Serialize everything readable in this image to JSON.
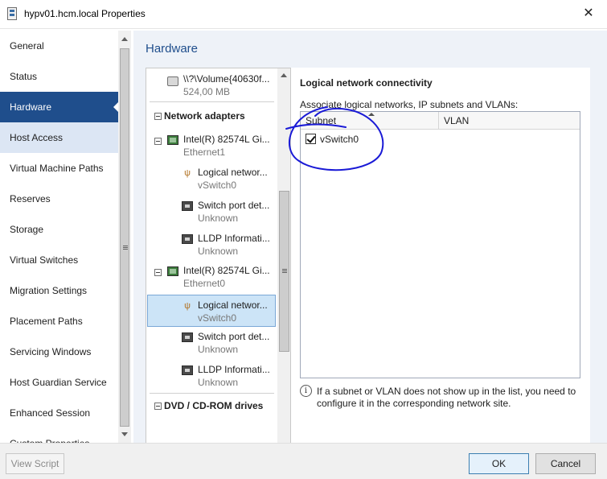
{
  "window": {
    "title": "hypv01.hcm.local Properties",
    "close_glyph": "✕"
  },
  "sidebar": {
    "items": [
      {
        "label": "General"
      },
      {
        "label": "Status"
      },
      {
        "label": "Hardware"
      },
      {
        "label": "Host Access"
      },
      {
        "label": "Virtual Machine Paths"
      },
      {
        "label": "Reserves"
      },
      {
        "label": "Storage"
      },
      {
        "label": "Virtual Switches"
      },
      {
        "label": "Migration Settings"
      },
      {
        "label": "Placement Paths"
      },
      {
        "label": "Servicing Windows"
      },
      {
        "label": "Host Guardian Service"
      },
      {
        "label": "Enhanced Session"
      },
      {
        "label": "Custom Properties"
      }
    ]
  },
  "main": {
    "heading": "Hardware"
  },
  "tree": {
    "volume_path": "\\\\?\\Volume{40630f...",
    "volume_size": "524,00 MB",
    "network_header": "Network adapters",
    "adapter1_name": "Intel(R) 82574L Gi...",
    "adapter1_sub": "Ethernet1",
    "a1_logical": "Logical networ...",
    "a1_logical_sub": "vSwitch0",
    "a1_port": "Switch port det...",
    "a1_port_sub": "Unknown",
    "a1_lldp": "LLDP Informati...",
    "a1_lldp_sub": "Unknown",
    "adapter2_name": "Intel(R) 82574L Gi...",
    "adapter2_sub": "Ethernet0",
    "a2_logical": "Logical networ...",
    "a2_logical_sub": "vSwitch0",
    "a2_port": "Switch port det...",
    "a2_port_sub": "Unknown",
    "a2_lldp": "LLDP Informati...",
    "a2_lldp_sub": "Unknown",
    "dvd_header": "DVD / CD-ROM drives"
  },
  "details": {
    "title": "Logical network connectivity",
    "description": "Associate logical networks, IP subnets and VLANs:",
    "columns": {
      "subnet": "Subnet",
      "vlan": "VLAN"
    },
    "rows": [
      {
        "name": "vSwitch0",
        "checked": true
      }
    ],
    "info": "If a subnet or VLAN does not show up in the list, you need to configure it in the corresponding network site."
  },
  "buttons": {
    "view_script": "View Script",
    "ok": "OK",
    "cancel": "Cancel"
  },
  "colors": {
    "accent": "#1f4e8c",
    "annotation": "#1a1ad6"
  }
}
